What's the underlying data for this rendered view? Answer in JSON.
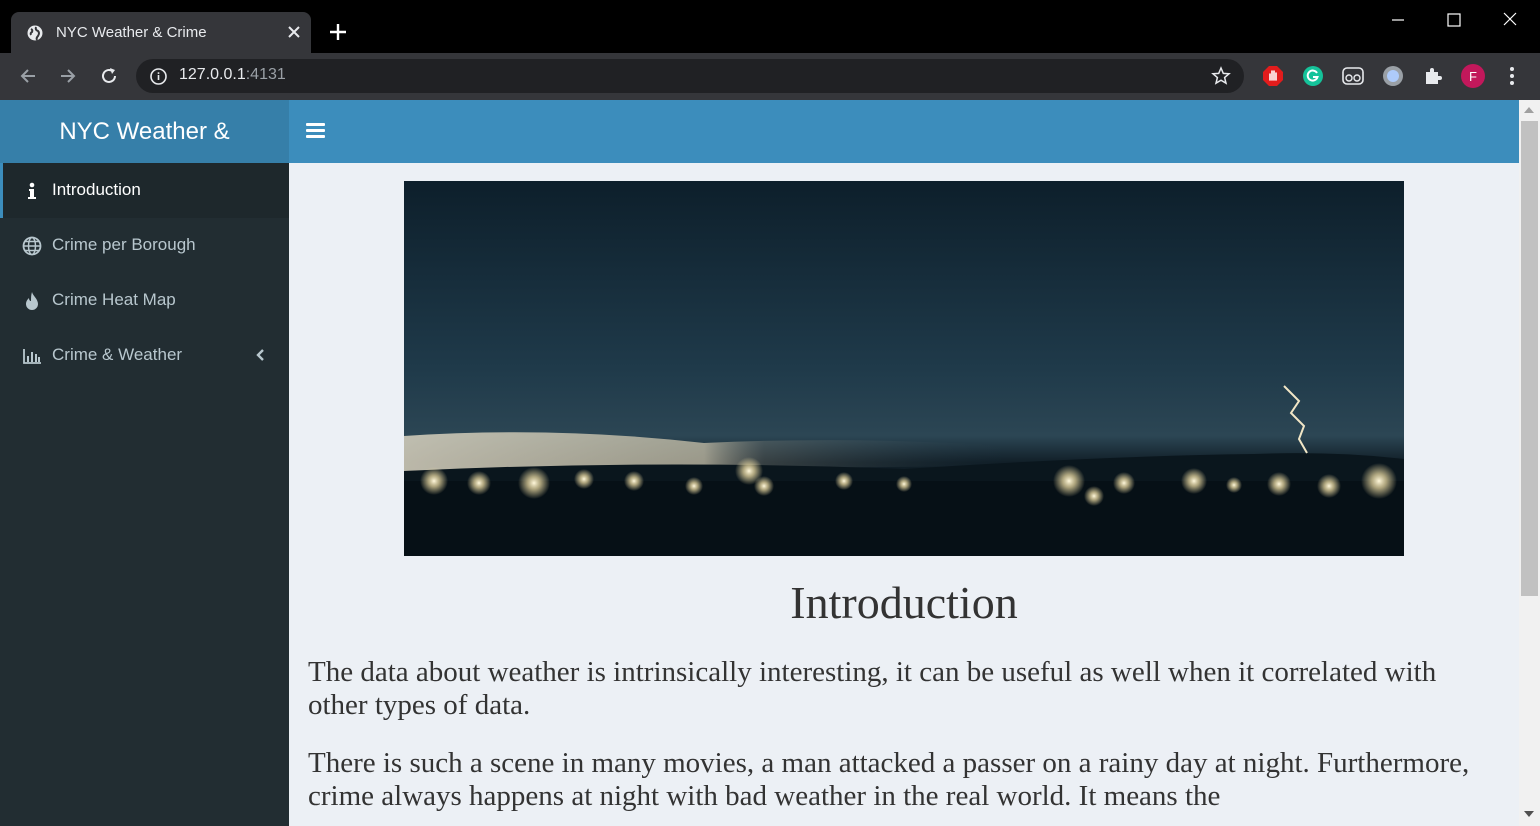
{
  "browser": {
    "tab_title": "NYC Weather & Crime",
    "url_host": "127.0.0.1",
    "url_port": ":4131",
    "profile_initial": "F"
  },
  "app": {
    "logo_text": "NYC Weather &",
    "menu": [
      {
        "label": "Introduction",
        "icon": "info-icon",
        "active": true
      },
      {
        "label": "Crime per Borough",
        "icon": "globe-icon",
        "active": false
      },
      {
        "label": "Crime Heat Map",
        "icon": "fire-icon",
        "active": false
      },
      {
        "label": "Crime & Weather",
        "icon": "bar-chart-icon",
        "active": false,
        "has_submenu": true
      }
    ],
    "colors": {
      "header": "#3c8dbc",
      "logo": "#367fa9",
      "sidebar": "#222d32",
      "sidebar_active": "#1e282c"
    }
  },
  "content": {
    "hero_image": "night-lightning-skyline",
    "title": "Introduction",
    "paragraphs": [
      "The data about weather is intrinsically interesting, it can be useful as well when it correlated with other types of data.",
      "There is such a scene in many movies, a man attacked a passer on a rainy day at night. Furthermore, crime always happens at night with bad weather in the real world. It means the"
    ]
  }
}
